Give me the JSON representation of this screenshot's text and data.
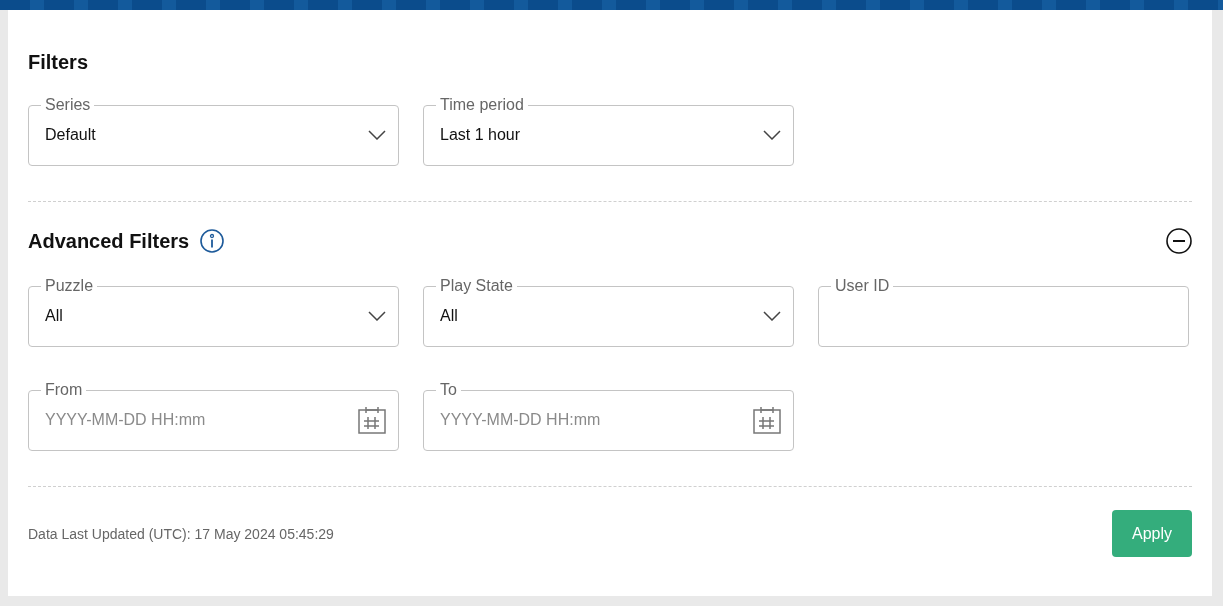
{
  "filters": {
    "title": "Filters",
    "fields": [
      {
        "kind": "select",
        "label": "Series",
        "value": "Default"
      },
      {
        "kind": "select",
        "label": "Time period",
        "value": "Last 1 hour"
      }
    ]
  },
  "advanced_filters": {
    "title": "Advanced Filters",
    "expanded": true,
    "rows": [
      [
        {
          "kind": "select",
          "label": "Puzzle",
          "value": "All"
        },
        {
          "kind": "select",
          "label": "Play State",
          "value": "All"
        },
        {
          "kind": "text",
          "label": "User ID"
        }
      ],
      [
        {
          "kind": "date",
          "label": "From",
          "placeholder": "YYYY-MM-DD HH:mm"
        },
        {
          "kind": "date",
          "label": "To",
          "placeholder": "YYYY-MM-DD HH:mm"
        }
      ]
    ]
  },
  "footer": {
    "last_updated": "Data Last Updated (UTC): 17 May 2024 05:45:29",
    "apply_button": "Apply"
  }
}
